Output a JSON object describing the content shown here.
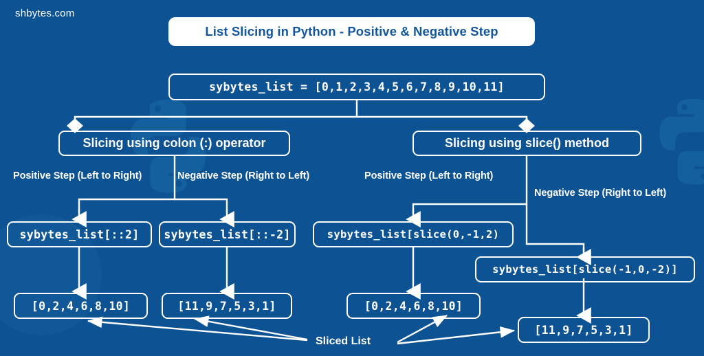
{
  "brand": "shbytes.com",
  "theme": {
    "background": "#0d5293",
    "box_border": "#ffffff",
    "title_bg": "#ffffff",
    "title_text": "#14569b",
    "text": "#ffffff",
    "watermark": "#14609f"
  },
  "title": "List Slicing in Python - Positive & Negative Step",
  "root": "sybytes_list = [0,1,2,3,4,5,6,7,8,9,10,11]",
  "branches": {
    "colon": "Slicing using colon (:) operator",
    "slice": "Slicing using slice() method"
  },
  "labels": {
    "colon_positive": "Positive Step (Left to Right)",
    "colon_negative": "Negative Step (Right to Left)",
    "slice_positive": "Positive Step (Left to Right)",
    "slice_negative": "Negative Step (Right to Left)",
    "sliced_list": "Sliced List"
  },
  "expressions": {
    "colon_positive": "sybytes_list[::2]",
    "colon_negative": "sybytes_list[::-2]",
    "slice_positive": "sybytes_list[slice(0,-1,2)",
    "slice_negative": "sybytes_list[slice(-1,0,-2)]"
  },
  "results": {
    "colon_positive": "[0,2,4,6,8,10]",
    "colon_negative": "[11,9,7,5,3,1]",
    "slice_positive": "[0,2,4,6,8,10]",
    "slice_negative": "[11,9,7,5,3,1]"
  }
}
